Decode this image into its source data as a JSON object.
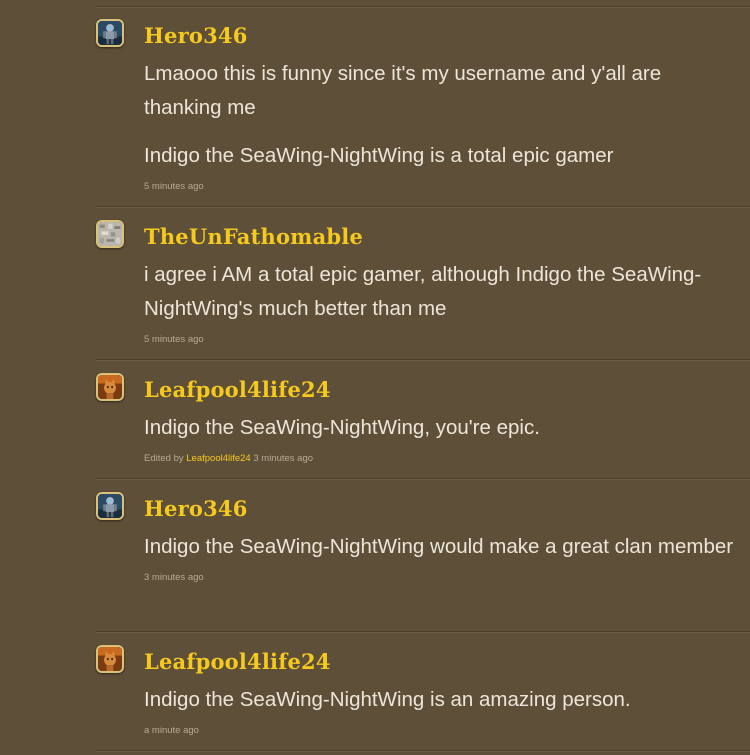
{
  "comments": [
    {
      "username": "Hero346",
      "avatar": "robot-warrior-avatar",
      "paragraphs": [
        "Lmaooo this is funny since it's my username and y'all are thanking me",
        "Indigo the SeaWing-NightWing is a total epic gamer"
      ],
      "timestamp": "5 minutes ago"
    },
    {
      "username": "TheUnFathomable",
      "avatar": "gray-texture-avatar",
      "paragraphs": [
        "i agree i AM a total epic gamer, although Indigo the SeaWing-NightWing's much better than me"
      ],
      "timestamp": "5 minutes ago"
    },
    {
      "username": "Leafpool4life24",
      "avatar": "cat-avatar",
      "paragraphs": [
        "Indigo the SeaWing-NightWing, you're epic."
      ],
      "edited_prefix": "Edited by",
      "edited_by": "Leafpool4life24",
      "timestamp": "3 minutes ago"
    },
    {
      "username": "Hero346",
      "avatar": "robot-warrior-avatar",
      "paragraphs": [
        "Indigo the SeaWing-NightWing would make a great clan member"
      ],
      "timestamp": "3 minutes ago"
    },
    {
      "username": "Leafpool4life24",
      "avatar": "cat-avatar",
      "paragraphs": [
        "Indigo the SeaWing-NightWing is an amazing person."
      ],
      "timestamp": "a minute ago"
    }
  ],
  "colors": {
    "background": "#5e4f39",
    "username": "#f6c91f",
    "text": "#ece6d8",
    "meta": "#b7ab94"
  }
}
